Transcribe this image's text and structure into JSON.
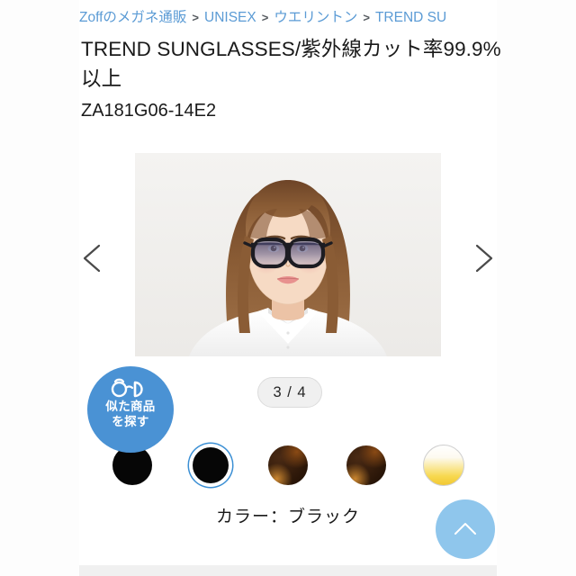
{
  "breadcrumb": {
    "separator": ">",
    "items": [
      {
        "label": "Zoffのメガネ通販"
      },
      {
        "label": "UNISEX"
      },
      {
        "label": "ウエリントン"
      },
      {
        "label": "TREND SU"
      }
    ]
  },
  "product": {
    "title": "TREND SUNGLASSES/紫外線カット率99.9%以上",
    "code": "ZA181G06-14E2",
    "color_label": "カラー：ブラック"
  },
  "carousel": {
    "page_indicator": "3 / 4",
    "current_index": 3,
    "total": 4,
    "prev_label": "前へ",
    "next_label": "次へ",
    "image_alt": "サングラスを掛けた女性モデルの正面写真"
  },
  "similar_badge": {
    "line1": "似た商品",
    "line2": "を探す",
    "icon": "glasses-icon",
    "color": "#4a92d4"
  },
  "swatches": [
    {
      "name": "ブラック",
      "kind": "black",
      "selected": false
    },
    {
      "name": "ブラック",
      "kind": "black",
      "selected": true
    },
    {
      "name": "ブラウンデミ",
      "kind": "tortoise",
      "selected": false
    },
    {
      "name": "ブラウンデミ",
      "kind": "tortoise",
      "selected": false
    },
    {
      "name": "イエロー",
      "kind": "yellow",
      "selected": false
    }
  ],
  "scroll_top": {
    "icon": "chevron-up-icon",
    "color": "#8fc6ec"
  },
  "colors": {
    "link": "#5b9bd5",
    "text": "#1a1a1a",
    "accent": "#4a92d4",
    "fab": "#8fc6ec",
    "panel": "#ffffff",
    "band": "#f0f0f0"
  }
}
